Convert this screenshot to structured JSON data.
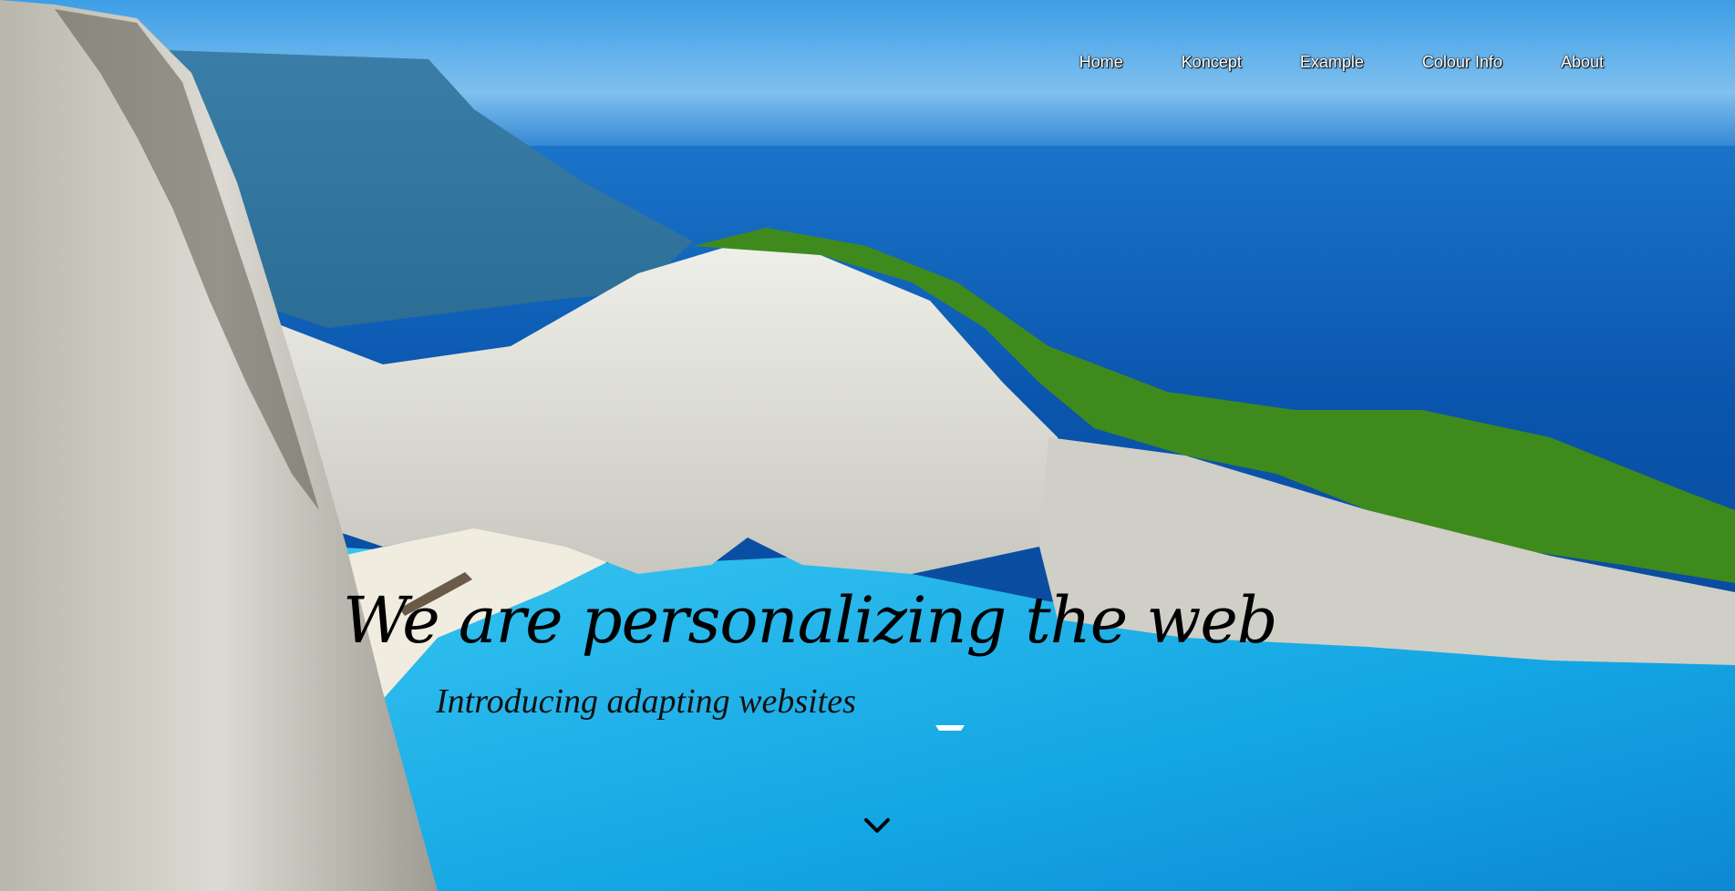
{
  "nav": {
    "items": [
      {
        "label": "Home"
      },
      {
        "label": "Koncept"
      },
      {
        "label": "Example"
      },
      {
        "label": "Colour Info"
      },
      {
        "label": "About"
      }
    ]
  },
  "hero": {
    "headline": "We are personalizing the web",
    "subline": "Introducing adapting websites",
    "scroll_icon": "chevron-down-icon"
  },
  "colors": {
    "sky": "#4aa9e8",
    "sea_deep": "#0b4fa6",
    "lagoon": "#1fb2e6",
    "cliff": "#e6e6e2",
    "forest": "#3f8a1d",
    "text": "#000000",
    "nav_text": "#ffffff"
  }
}
